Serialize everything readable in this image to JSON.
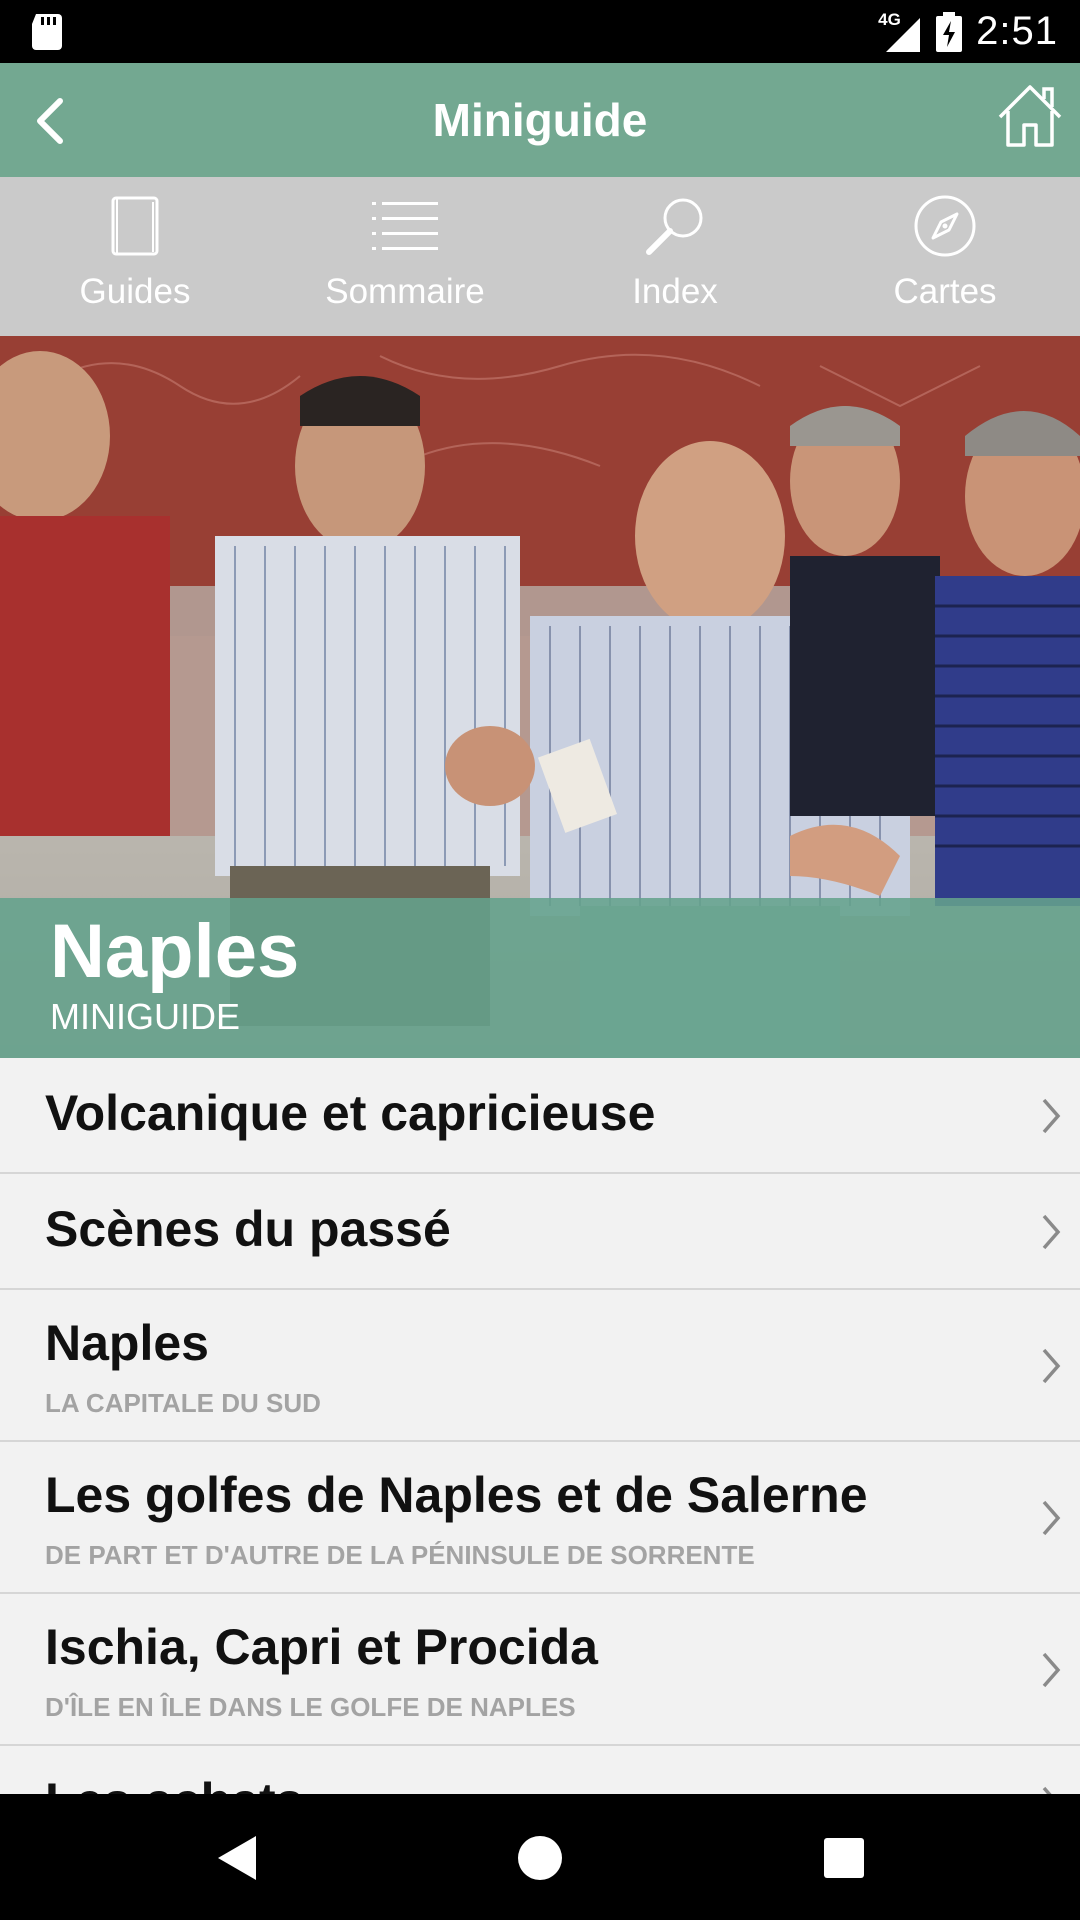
{
  "status_bar": {
    "time": "2:51",
    "network": "4G",
    "icons": [
      "sd-card-icon",
      "signal-icon",
      "battery-charging-icon"
    ]
  },
  "app_bar": {
    "title": "Miniguide",
    "icons": [
      "back-icon",
      "home-icon"
    ]
  },
  "toolbar": {
    "items": [
      {
        "label": "Guides",
        "icon": "book-icon"
      },
      {
        "label": "Sommaire",
        "icon": "list-icon"
      },
      {
        "label": "Index",
        "icon": "search-icon"
      },
      {
        "label": "Cartes",
        "icon": "compass-icon"
      }
    ]
  },
  "hero": {
    "title": "Naples",
    "subtitle": "MINIGUIDE"
  },
  "list": {
    "items": [
      {
        "title": "Volcanique et capricieuse",
        "subtitle": ""
      },
      {
        "title": "Scènes du passé",
        "subtitle": ""
      },
      {
        "title": "Naples",
        "subtitle": "LA CAPITALE DU SUD"
      },
      {
        "title": "Les golfes de Naples et de Salerne",
        "subtitle": "DE PART ET D'AUTRE DE LA PÉNINSULE DE SORRENTE"
      },
      {
        "title": "Ischia, Capri et Procida",
        "subtitle": "D'ÎLE EN ÎLE DANS LE GOLFE DE NAPLES"
      },
      {
        "title": "Les achats",
        "subtitle": ""
      }
    ]
  },
  "nav_bar": {
    "icons": [
      "nav-back-icon",
      "nav-home-icon",
      "nav-recents-icon"
    ]
  },
  "colors": {
    "app_bar": "#73a891",
    "toolbar": "#cacaca",
    "hero_overlay": "#64a28c",
    "list_background": "#f2f2f2",
    "subtitle": "#a3a3a3"
  }
}
